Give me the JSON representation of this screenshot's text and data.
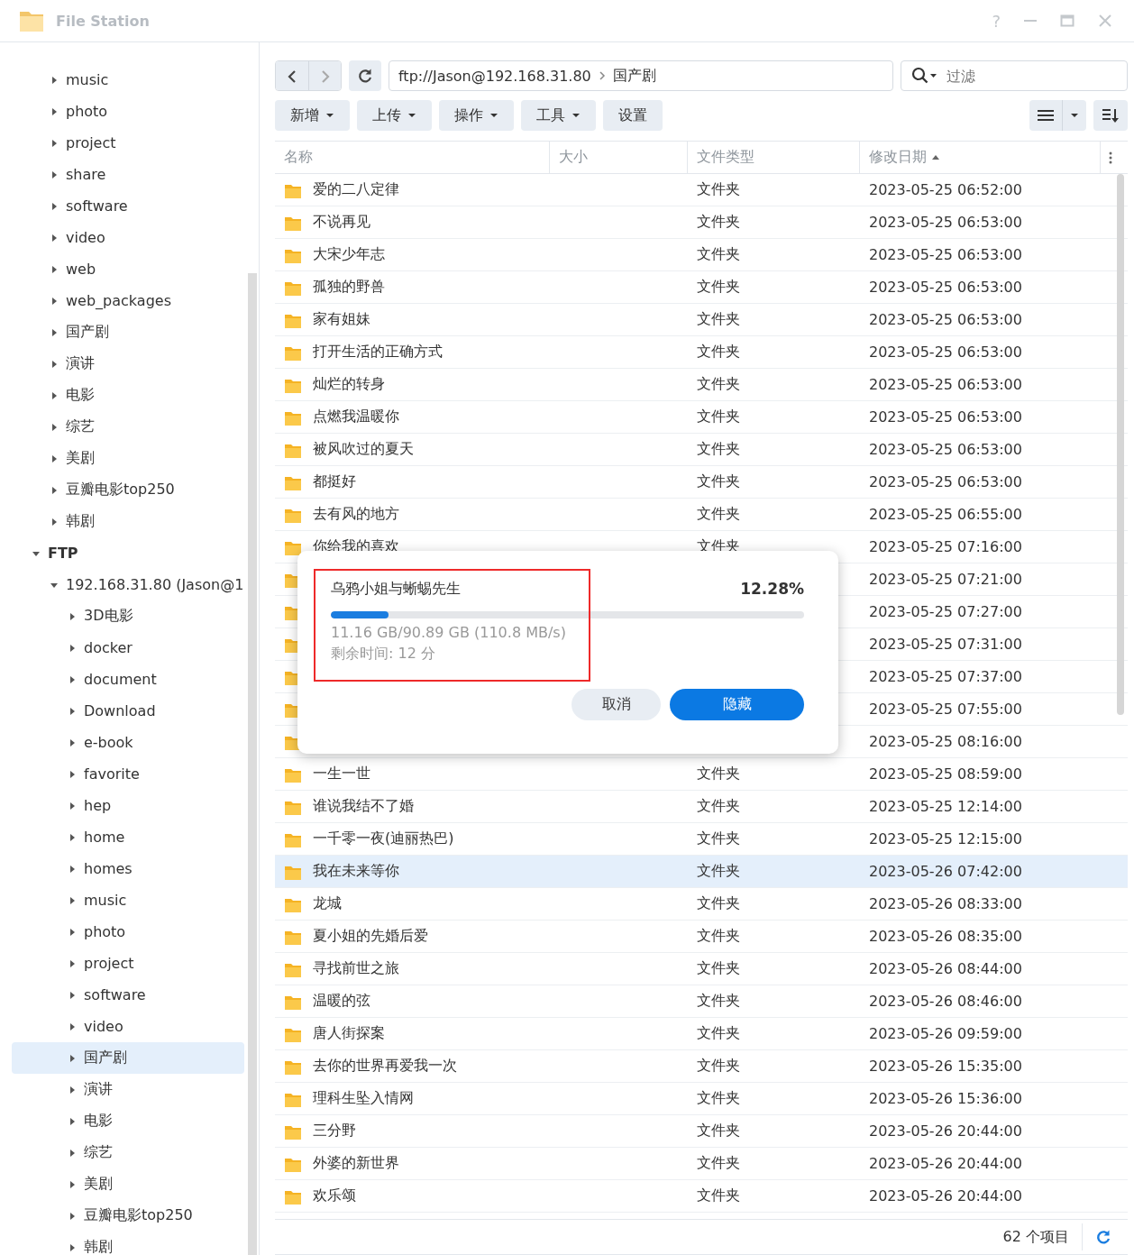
{
  "window": {
    "title": "File Station",
    "help": "?"
  },
  "sidebar": {
    "upper_items": [
      {
        "label": "music",
        "selected": false
      },
      {
        "label": "photo",
        "selected": false
      },
      {
        "label": "project",
        "selected": false
      },
      {
        "label": "share",
        "selected": false
      },
      {
        "label": "software",
        "selected": false
      },
      {
        "label": "video",
        "selected": false
      },
      {
        "label": "web",
        "selected": false
      },
      {
        "label": "web_packages",
        "selected": false
      },
      {
        "label": "国产剧",
        "selected": false
      },
      {
        "label": "演讲",
        "selected": false
      },
      {
        "label": "电影",
        "selected": false
      },
      {
        "label": "综艺",
        "selected": false
      },
      {
        "label": "美剧",
        "selected": false
      },
      {
        "label": "豆瓣电影top250",
        "selected": false
      },
      {
        "label": "韩剧",
        "selected": false
      }
    ],
    "tree": [
      {
        "label": "FTP",
        "expanded": true,
        "selected": false,
        "children": [
          {
            "label": "192.168.31.80 (Jason@1",
            "expanded": true,
            "selected": false,
            "children": [
              {
                "label": "3D电影",
                "expanded": false,
                "selected": false
              },
              {
                "label": "docker",
                "expanded": false,
                "selected": false
              },
              {
                "label": "document",
                "expanded": false,
                "selected": false
              },
              {
                "label": "Download",
                "expanded": false,
                "selected": false
              },
              {
                "label": "e-book",
                "expanded": false,
                "selected": false
              },
              {
                "label": "favorite",
                "expanded": false,
                "selected": false
              },
              {
                "label": "hep",
                "expanded": false,
                "selected": false
              },
              {
                "label": "home",
                "expanded": false,
                "selected": false
              },
              {
                "label": "homes",
                "expanded": false,
                "selected": false
              },
              {
                "label": "music",
                "expanded": false,
                "selected": false
              },
              {
                "label": "photo",
                "expanded": false,
                "selected": false
              },
              {
                "label": "project",
                "expanded": false,
                "selected": false
              },
              {
                "label": "software",
                "expanded": false,
                "selected": false
              },
              {
                "label": "video",
                "expanded": false,
                "selected": false
              },
              {
                "label": "国产剧",
                "expanded": false,
                "selected": true
              },
              {
                "label": "演讲",
                "expanded": false,
                "selected": false
              },
              {
                "label": "电影",
                "expanded": false,
                "selected": false
              },
              {
                "label": "综艺",
                "expanded": false,
                "selected": false
              },
              {
                "label": "美剧",
                "expanded": false,
                "selected": false
              },
              {
                "label": "豆瓣电影top250",
                "expanded": false,
                "selected": false
              },
              {
                "label": "韩剧",
                "expanded": false,
                "selected": false
              }
            ]
          }
        ]
      }
    ]
  },
  "path": {
    "host": "ftp://Jason@192.168.31.80",
    "folder": "国产剧"
  },
  "search": {
    "placeholder": "过滤"
  },
  "toolbar": [
    {
      "label": "新增",
      "dropdown": true
    },
    {
      "label": "上传",
      "dropdown": true
    },
    {
      "label": "操作",
      "dropdown": true
    },
    {
      "label": "工具",
      "dropdown": true
    },
    {
      "label": "设置",
      "dropdown": false
    }
  ],
  "table": {
    "columns": [
      {
        "label": "名称",
        "sorted": false
      },
      {
        "label": "大小",
        "sorted": false
      },
      {
        "label": "文件类型",
        "sorted": false
      },
      {
        "label": "修改日期",
        "sorted": true
      }
    ],
    "rows": [
      {
        "name": "爱的二八定律",
        "type": "文件夹",
        "modified": "2023-05-25 06:52:00",
        "selected": false
      },
      {
        "name": "不说再见",
        "type": "文件夹",
        "modified": "2023-05-25 06:53:00",
        "selected": false
      },
      {
        "name": "大宋少年志",
        "type": "文件夹",
        "modified": "2023-05-25 06:53:00",
        "selected": false
      },
      {
        "name": "孤独的野兽",
        "type": "文件夹",
        "modified": "2023-05-25 06:53:00",
        "selected": false
      },
      {
        "name": "家有姐妹",
        "type": "文件夹",
        "modified": "2023-05-25 06:53:00",
        "selected": false
      },
      {
        "name": "打开生活的正确方式",
        "type": "文件夹",
        "modified": "2023-05-25 06:53:00",
        "selected": false
      },
      {
        "name": "灿烂的转身",
        "type": "文件夹",
        "modified": "2023-05-25 06:53:00",
        "selected": false
      },
      {
        "name": "点燃我温暖你",
        "type": "文件夹",
        "modified": "2023-05-25 06:53:00",
        "selected": false
      },
      {
        "name": "被风吹过的夏天",
        "type": "文件夹",
        "modified": "2023-05-25 06:53:00",
        "selected": false
      },
      {
        "name": "都挺好",
        "type": "文件夹",
        "modified": "2023-05-25 06:53:00",
        "selected": false
      },
      {
        "name": "去有风的地方",
        "type": "文件夹",
        "modified": "2023-05-25 06:55:00",
        "selected": false
      },
      {
        "name": "你给我的喜欢",
        "type": "文件夹",
        "modified": "2023-05-25 07:16:00",
        "selected": false
      },
      {
        "modified": "2023-05-25 07:21:00",
        "selected": false
      },
      {
        "modified": "2023-05-25 07:27:00",
        "selected": false
      },
      {
        "modified": "2023-05-25 07:31:00",
        "selected": false
      },
      {
        "modified": "2023-05-25 07:37:00",
        "selected": false
      },
      {
        "modified": "2023-05-25 07:55:00",
        "selected": false
      },
      {
        "modified": "2023-05-25 08:16:00",
        "selected": false
      },
      {
        "name": "一生一世",
        "type": "文件夹",
        "modified": "2023-05-25 08:59:00",
        "selected": false
      },
      {
        "name": "谁说我结不了婚",
        "type": "文件夹",
        "modified": "2023-05-25 12:14:00",
        "selected": false
      },
      {
        "name": "一千零一夜(迪丽热巴)",
        "type": "文件夹",
        "modified": "2023-05-25 12:15:00",
        "selected": false
      },
      {
        "name": "我在未来等你",
        "type": "文件夹",
        "modified": "2023-05-26 07:42:00",
        "selected": true
      },
      {
        "name": "龙城",
        "type": "文件夹",
        "modified": "2023-05-26 08:33:00",
        "selected": false
      },
      {
        "name": "夏小姐的先婚后爱",
        "type": "文件夹",
        "modified": "2023-05-26 08:35:00",
        "selected": false
      },
      {
        "name": "寻找前世之旅",
        "type": "文件夹",
        "modified": "2023-05-26 08:44:00",
        "selected": false
      },
      {
        "name": "温暖的弦",
        "type": "文件夹",
        "modified": "2023-05-26 08:46:00",
        "selected": false
      },
      {
        "name": "唐人街探案",
        "type": "文件夹",
        "modified": "2023-05-26 09:59:00",
        "selected": false
      },
      {
        "name": "去你的世界再爱我一次",
        "type": "文件夹",
        "modified": "2023-05-26 15:35:00",
        "selected": false
      },
      {
        "name": "理科生坠入情网",
        "type": "文件夹",
        "modified": "2023-05-26 15:36:00",
        "selected": false
      },
      {
        "name": "三分野",
        "type": "文件夹",
        "modified": "2023-05-26 20:44:00",
        "selected": false
      },
      {
        "name": "外婆的新世界",
        "type": "文件夹",
        "modified": "2023-05-26 20:44:00",
        "selected": false
      },
      {
        "name": "欢乐颂",
        "type": "文件夹",
        "modified": "2023-05-26 20:44:00",
        "selected": false
      }
    ]
  },
  "status_bar": {
    "count": "62 个项目"
  },
  "dialog": {
    "title": "乌鸦小姐与蜥蜴先生",
    "percent": "12.28%",
    "level": 0.1228,
    "detail": "11.16 GB/90.89 GB (110.8 MB/s)",
    "remaining": "剩余时间: 12 分",
    "highlighted": true,
    "buttons": [
      {
        "label": "取消",
        "kind": "secondary"
      },
      {
        "label": "隐藏",
        "kind": "primary"
      }
    ]
  }
}
